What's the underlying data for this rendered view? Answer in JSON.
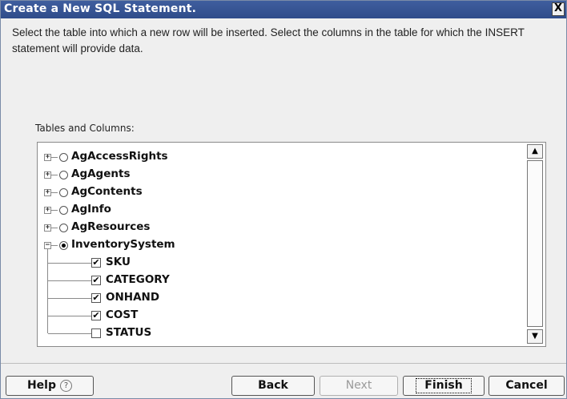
{
  "dialog": {
    "title": "Create a New SQL Statement.",
    "close_label": "X",
    "description": "Select the table into which a new row will be inserted. Select the columns in the table for which the INSERT statement will provide data.",
    "tree_label": "Tables and Columns:"
  },
  "tree": {
    "tables": [
      {
        "label": "AgAccessRights",
        "expanded": false,
        "selected": false
      },
      {
        "label": "AgAgents",
        "expanded": false,
        "selected": false
      },
      {
        "label": "AgContents",
        "expanded": false,
        "selected": false
      },
      {
        "label": "AgInfo",
        "expanded": false,
        "selected": false
      },
      {
        "label": "AgResources",
        "expanded": false,
        "selected": false
      },
      {
        "label": "InventorySystem",
        "expanded": true,
        "selected": true
      }
    ],
    "columns": [
      {
        "label": "SKU",
        "checked": true
      },
      {
        "label": "CATEGORY",
        "checked": true
      },
      {
        "label": "ONHAND",
        "checked": true
      },
      {
        "label": "COST",
        "checked": true
      },
      {
        "label": "STATUS",
        "checked": false
      }
    ]
  },
  "scroll": {
    "up_icon": "chevron-up-icon",
    "down_icon": "chevron-down-icon"
  },
  "buttons": {
    "help": "Help",
    "help_icon": "?",
    "back": "Back",
    "next": "Next",
    "finish": "Finish",
    "cancel": "Cancel"
  }
}
